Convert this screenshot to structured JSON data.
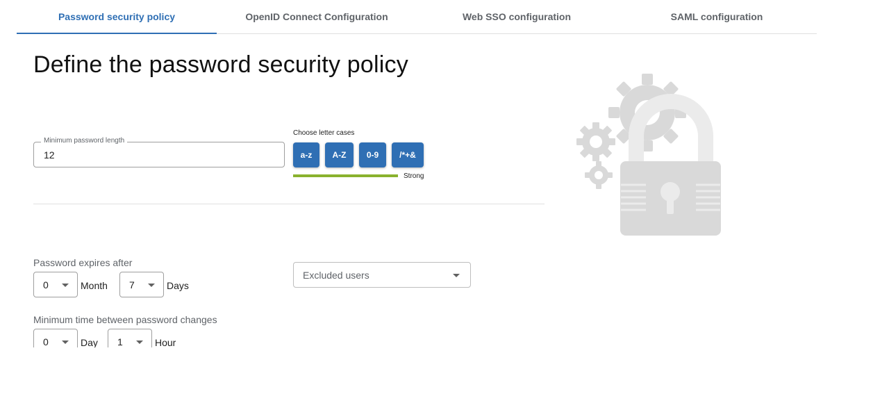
{
  "tabs": [
    {
      "label": "Password security policy",
      "active": true
    },
    {
      "label": "OpenID Connect Configuration",
      "active": false
    },
    {
      "label": "Web SSO configuration",
      "active": false
    },
    {
      "label": "SAML configuration",
      "active": false
    }
  ],
  "page_title": "Define the password security policy",
  "min_length": {
    "label": "Minimum password length",
    "value": "12"
  },
  "letter_cases": {
    "label": "Choose letter cases",
    "buttons": [
      "a-z",
      "A-Z",
      "0-9",
      "/*+&"
    ],
    "strength_label": "Strong",
    "strength_color": "#8ab22e"
  },
  "expiry": {
    "label": "Password expires after",
    "month_value": "0",
    "month_unit": "Month",
    "days_value": "7",
    "days_unit": "Days"
  },
  "excluded_users": {
    "placeholder": "Excluded users"
  },
  "min_change": {
    "label": "Minimum time between password changes",
    "day_value": "0",
    "day_unit": "Day",
    "hour_value": "1",
    "hour_unit": "Hour"
  },
  "colors": {
    "accent": "#2f6fb4",
    "illustration": "#d9d9d9"
  },
  "icons": {
    "illustration": "gear-padlock-illustration",
    "dropdown": "caret-down-icon"
  }
}
